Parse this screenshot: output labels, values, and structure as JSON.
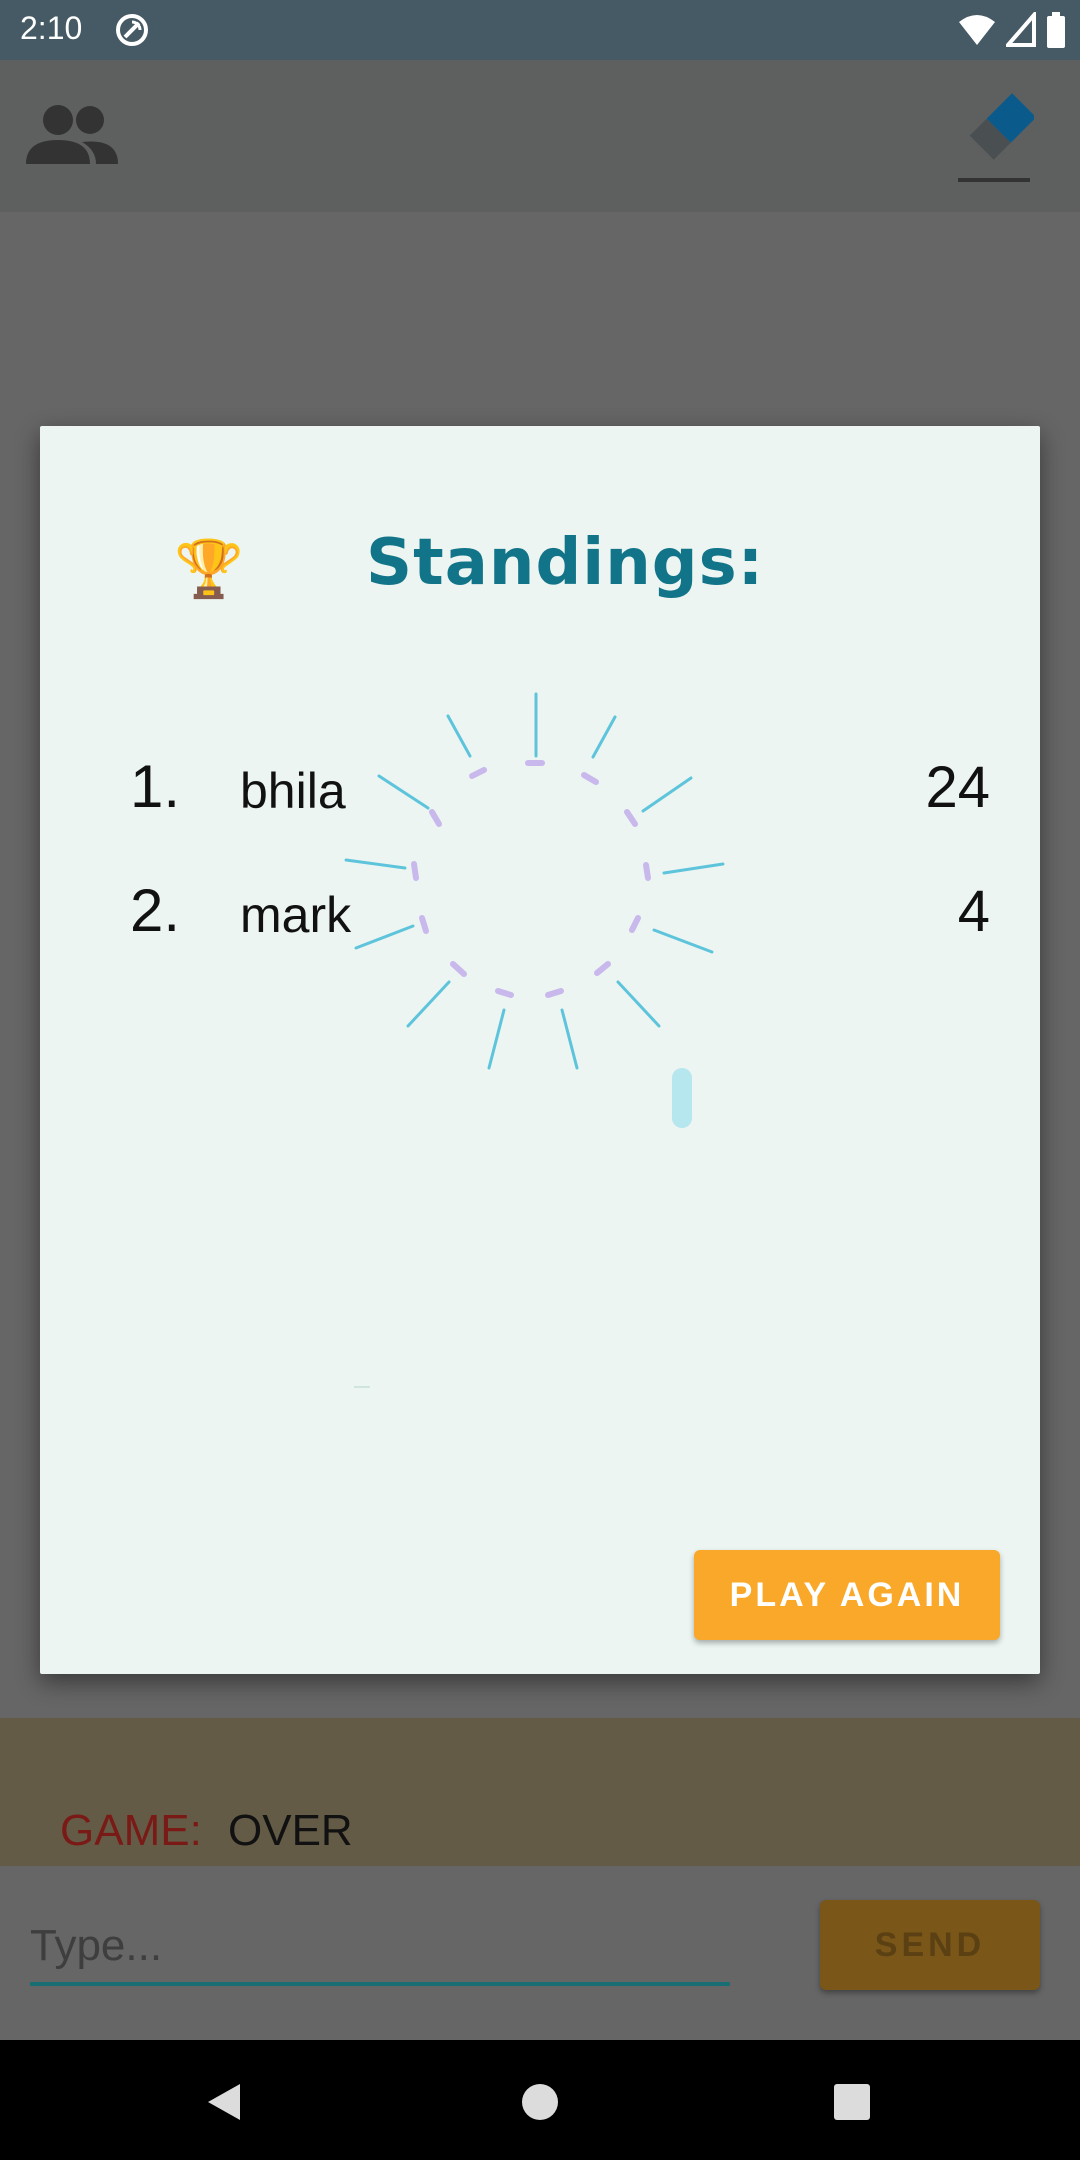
{
  "status_bar": {
    "time": "2:10",
    "icons": [
      "sync-icon",
      "wifi-icon",
      "signal-icon",
      "battery-icon"
    ]
  },
  "app_bar": {
    "icons": [
      "players-icon",
      "eraser-icon"
    ],
    "accent_color": "#0a5a8c"
  },
  "dialog": {
    "title": "Standings:",
    "trophy_icon": "🏆",
    "standings": [
      {
        "rank": "1.",
        "name": "bhila",
        "score": "24"
      },
      {
        "rank": "2.",
        "name": "mark",
        "score": "4"
      }
    ],
    "play_again_label": "PLAY AGAIN",
    "title_color": "#127489",
    "button_color": "#f9a829"
  },
  "game_status": {
    "label": "GAME:",
    "value": "OVER"
  },
  "chat": {
    "placeholder": "Type...",
    "value": "",
    "send_label": "SEND"
  },
  "nav_bar": {
    "icons": [
      "back-icon",
      "home-icon",
      "recents-icon"
    ]
  }
}
